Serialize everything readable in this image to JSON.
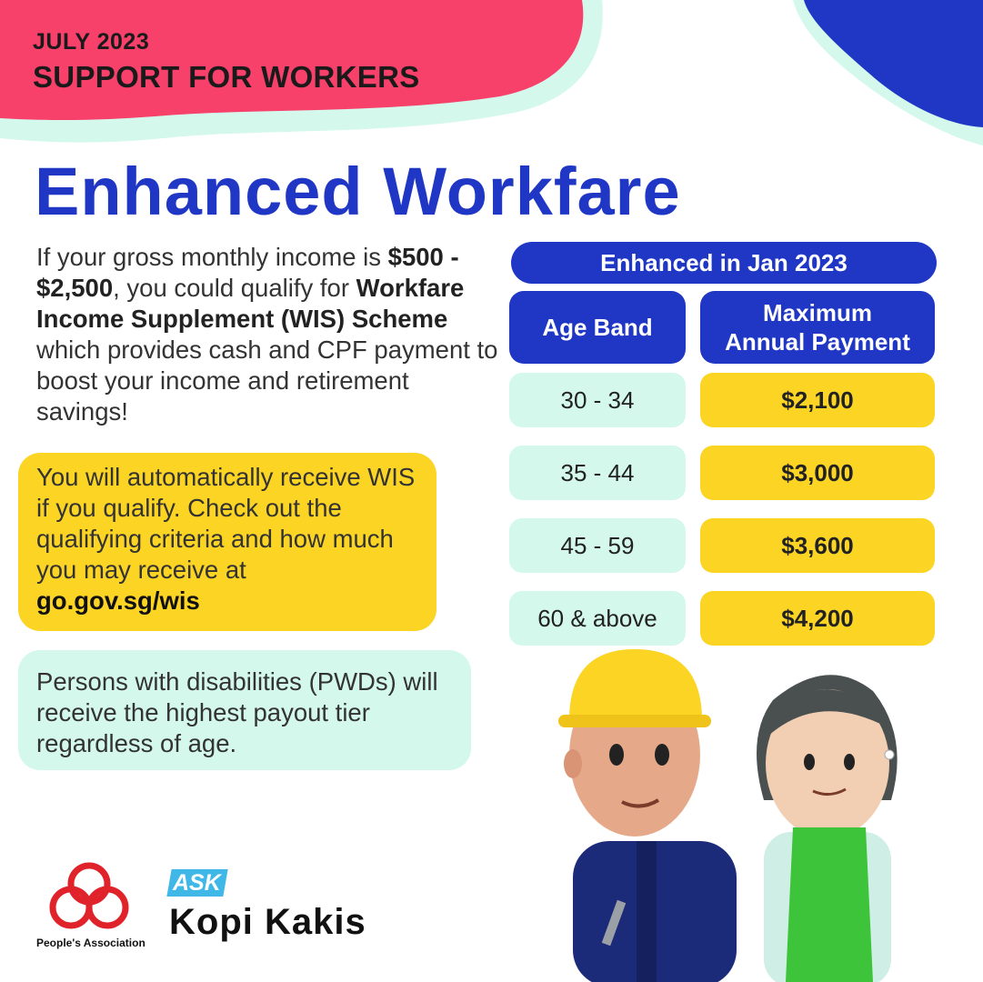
{
  "header": {
    "kicker": "JULY 2023",
    "heading": "SUPPORT FOR WORKERS"
  },
  "title": "Enhanced Workfare",
  "intro": {
    "part1": "If your gross monthly income is ",
    "income_range": "$500 - $2,500",
    "part2": ", you could qualify for ",
    "scheme_name": "Workfare Income Supplement (WIS) Scheme",
    "part3": " which provides cash and CPF payment to boost your income and retirement savings!"
  },
  "auto_box": {
    "text": "You will automatically receive WIS if you qualify. Check out the qualifying criteria and how much you may receive at",
    "url": "go.gov.sg/wis"
  },
  "pwd_box": {
    "text": "Persons with disabilities (PWDs) will receive the highest payout tier regardless of age."
  },
  "table": {
    "caption": "Enhanced in Jan 2023",
    "col_age": "Age Band",
    "col_payment_line1": "Maximum",
    "col_payment_line2": "Annual Payment",
    "rows": [
      {
        "age": "30 - 34",
        "payment": "$2,100"
      },
      {
        "age": "35 - 44",
        "payment": "$3,000"
      },
      {
        "age": "45 - 59",
        "payment": "$3,600"
      },
      {
        "age": "60 & above",
        "payment": "$4,200"
      }
    ]
  },
  "footer": {
    "pa_label": "People's Association",
    "ask_label": "ASK",
    "kopi_label": "Kopi Kakis"
  },
  "colors": {
    "brand_blue": "#1f37c4",
    "pink": "#f7406a",
    "yellow": "#fcd424",
    "mint": "#d4f8ec"
  }
}
